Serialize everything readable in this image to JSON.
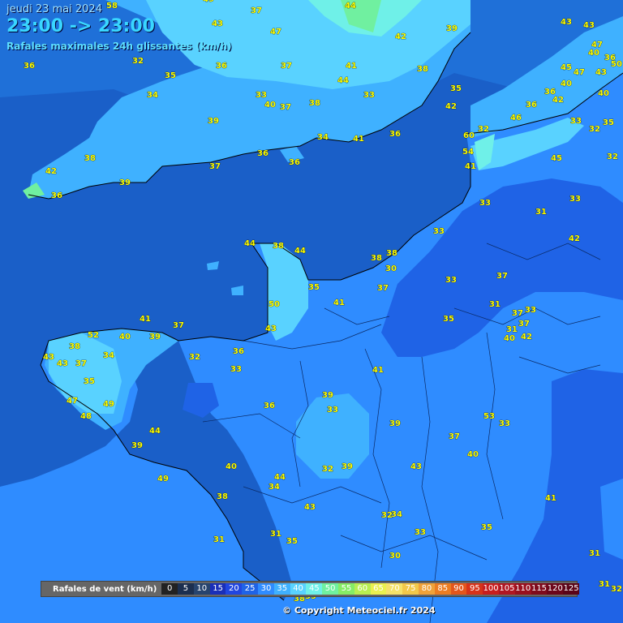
{
  "header": {
    "date": "jeudi 23 mai 2024",
    "time_range": "23:00 -> 23:00",
    "subtitle": "Rafales maximales 24h glissantes (km/h)"
  },
  "legend": {
    "title": "Rafales de vent (km/h)",
    "steps": [
      {
        "v": "0",
        "c": "#222222"
      },
      {
        "v": "5",
        "c": "#1c2f4f"
      },
      {
        "v": "10",
        "c": "#27446e"
      },
      {
        "v": "15",
        "c": "#1a2fb8"
      },
      {
        "v": "20",
        "c": "#2146e0"
      },
      {
        "v": "25",
        "c": "#1f63e6"
      },
      {
        "v": "30",
        "c": "#2f8cff"
      },
      {
        "v": "35",
        "c": "#3fb1ff"
      },
      {
        "v": "40",
        "c": "#59d2ff"
      },
      {
        "v": "45",
        "c": "#6ff0e8"
      },
      {
        "v": "50",
        "c": "#70f0a0"
      },
      {
        "v": "55",
        "c": "#86ec66"
      },
      {
        "v": "60",
        "c": "#b8ee52"
      },
      {
        "v": "65",
        "c": "#eaf050"
      },
      {
        "v": "70",
        "c": "#f5e26a"
      },
      {
        "v": "75",
        "c": "#f2c84a"
      },
      {
        "v": "80",
        "c": "#f0a23a"
      },
      {
        "v": "85",
        "c": "#ec7d22"
      },
      {
        "v": "90",
        "c": "#e4561c"
      },
      {
        "v": "95",
        "c": "#d7331a"
      },
      {
        "v": "100",
        "c": "#c81e1e"
      },
      {
        "v": "105",
        "c": "#b01622"
      },
      {
        "v": "110",
        "c": "#99101e"
      },
      {
        "v": "115",
        "c": "#7f0b1c"
      },
      {
        "v": "120",
        "c": "#6c061a"
      },
      {
        "v": "125",
        "c": "#5a0418"
      }
    ]
  },
  "copyright": "© Copyright Meteociel.fr 2024",
  "stations": [
    "58",
    "49",
    "37",
    "44",
    "43",
    "47",
    "39",
    "43",
    "43",
    "47",
    "36",
    "40",
    "50",
    "36",
    "32",
    "42",
    "35",
    "36",
    "37",
    "41",
    "44",
    "45",
    "47",
    "43",
    "40",
    "38",
    "40",
    "34",
    "33",
    "40",
    "37",
    "38",
    "33",
    "35",
    "42",
    "36",
    "42",
    "36",
    "46",
    "33",
    "35",
    "32",
    "39",
    "34",
    "41",
    "60",
    "32",
    "36",
    "54",
    "45",
    "42",
    "41",
    "39",
    "37",
    "36",
    "36",
    "33",
    "32",
    "33",
    "31",
    "33",
    "42",
    "38",
    "36",
    "44",
    "38",
    "44",
    "38",
    "38",
    "30",
    "37",
    "33",
    "37",
    "35",
    "41",
    "50",
    "31",
    "37",
    "33",
    "43",
    "35",
    "37",
    "41",
    "37",
    "31",
    "40",
    "42",
    "52",
    "40",
    "39",
    "43",
    "38",
    "34",
    "36",
    "32",
    "33",
    "43",
    "37",
    "35",
    "47",
    "49",
    "48",
    "44",
    "39",
    "41",
    "36",
    "33",
    "39",
    "37",
    "53",
    "33",
    "39",
    "49",
    "40",
    "44",
    "32",
    "39",
    "43",
    "40",
    "34",
    "38",
    "43",
    "32",
    "34",
    "35",
    "41",
    "31",
    "35",
    "33",
    "31",
    "30",
    "31",
    "31",
    "32",
    "35",
    "38"
  ],
  "colors": {
    "sea": "#1a5fc8",
    "land_30": "#2f8cff",
    "land_35": "#3fb1ff",
    "land_40": "#59d2ff",
    "land_45": "#6ff0e8",
    "land_50": "#70f0a0",
    "low_25": "#1f63e6",
    "low_20": "#2146e0",
    "label": "#ffff00"
  }
}
